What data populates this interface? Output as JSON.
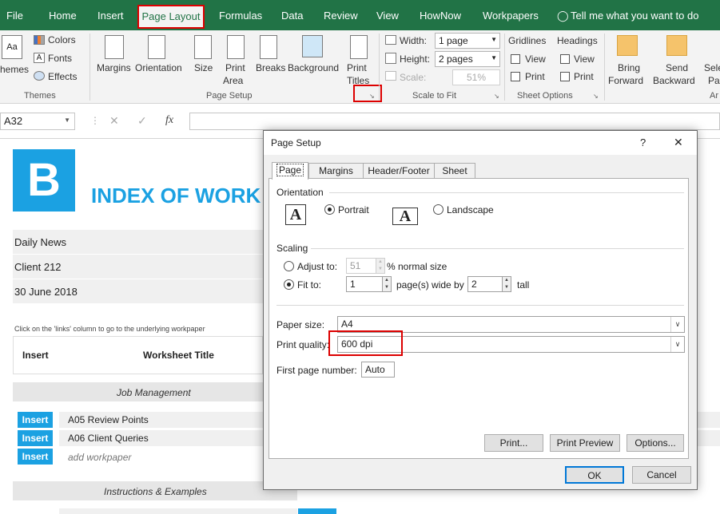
{
  "ribbon_tabs": [
    "File",
    "Home",
    "Insert",
    "Page Layout",
    "Formulas",
    "Data",
    "Review",
    "View",
    "HowNow",
    "Workpapers"
  ],
  "tell_me": "Tell me what you want to do",
  "themes": {
    "themes_label": "hemes",
    "colors": "Colors",
    "fonts": "Fonts",
    "effects": "Effects",
    "group": "Themes"
  },
  "page_setup_group": {
    "margins": "Margins",
    "orientation": "Orientation",
    "size": "Size",
    "print_area": [
      "Print",
      "Area"
    ],
    "breaks": "Breaks",
    "background": "Background",
    "print_titles": [
      "Print",
      "Titles"
    ],
    "group": "Page Setup"
  },
  "scale_to_fit": {
    "width_label": "Width:",
    "width_value": "1 page",
    "height_label": "Height:",
    "height_value": "2 pages",
    "scale_label": "Scale:",
    "scale_value": "51%",
    "group": "Scale to Fit"
  },
  "sheet_options": {
    "gridlines": "Gridlines",
    "headings": "Headings",
    "view": "View",
    "print": "Print",
    "group": "Sheet Options"
  },
  "arrange": {
    "bring_forward": [
      "Bring",
      "Forward"
    ],
    "send_backward": [
      "Send",
      "Backward"
    ],
    "selection": [
      "Sele",
      "Pa"
    ],
    "group": "Ar"
  },
  "name_box": "A32",
  "fx": "fx",
  "sheet": {
    "logo_letter": "B",
    "title": "INDEX OF WORK",
    "info_rows": [
      "Daily News",
      "Client 212",
      "30 June 2018"
    ],
    "hint": "Click on the 'links' column to go to the underlying workpaper",
    "col_insert": "Insert",
    "col_title": "Worksheet Title",
    "section1": "Job Management",
    "rows": [
      {
        "btn": "Insert",
        "text": "A05 Review Points"
      },
      {
        "btn": "Insert",
        "text": "A06 Client Queries"
      },
      {
        "btn": "Insert",
        "text": "add workpaper"
      }
    ],
    "section2": "Instructions & Examples"
  },
  "dialog": {
    "title": "Page Setup",
    "help": "?",
    "close": "✕",
    "tabs": [
      "Page",
      "Margins",
      "Header/Footer",
      "Sheet"
    ],
    "orientation": {
      "label": "Orientation",
      "portrait": "Portrait",
      "landscape": "Landscape",
      "icon_letter": "A"
    },
    "scaling": {
      "label": "Scaling",
      "adjust_to": "Adjust to:",
      "adjust_value": "51",
      "adjust_suffix": "% normal size",
      "fit_to": "Fit to:",
      "fit_wide": "1",
      "wide_label": "page(s) wide by",
      "fit_tall": "2",
      "tall_label": "tall"
    },
    "paper_size_label": "Paper size:",
    "paper_size": "A4",
    "print_quality_label": "Print quality:",
    "print_quality": "600 dpi",
    "first_page_label": "First page number:",
    "first_page": "Auto",
    "buttons": {
      "print": "Print...",
      "preview": "Print Preview",
      "options": "Options...",
      "ok": "OK",
      "cancel": "Cancel"
    }
  }
}
